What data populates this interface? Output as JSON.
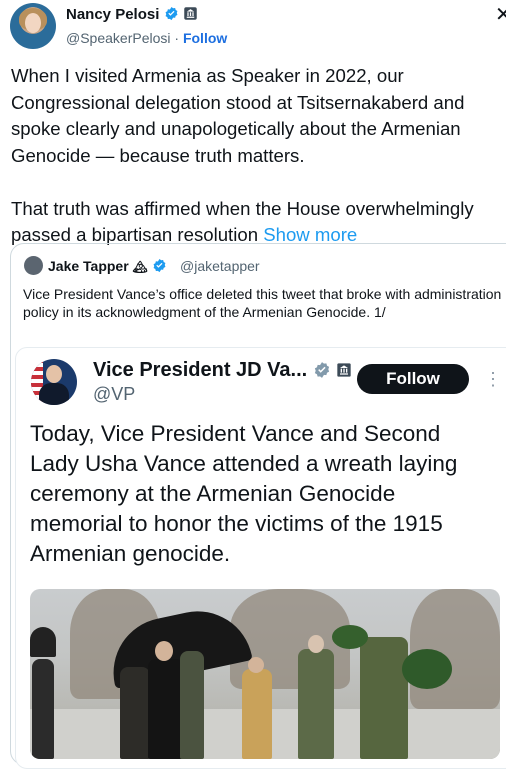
{
  "tweet": {
    "author_name": "Nancy Pelosi",
    "author_handle": "@SpeakerPelosi",
    "separator": "·",
    "follow_label": "Follow",
    "close_glyph": "✕",
    "text_lines": [
      "When I visited Armenia as Speaker in 2022, our",
      "Congressional delegation stood at Tsitsernakaberd and",
      "spoke clearly and unapologetically about the Armenian",
      "Genocide — because truth matters.",
      "",
      "That truth was affirmed when the House overwhelmingly",
      "passed a bipartisan resolution"
    ],
    "show_more": "Show more"
  },
  "quoted": {
    "author_name": "Jake Tapper",
    "badge_glyph": "🏔",
    "author_handle": "@jaketapper",
    "text": "Vice President Vance’s office deleted this tweet that broke with administration policy in its acknowledgment of the Armenian Genocide. 1/"
  },
  "embedded": {
    "author_name": "Vice President JD Va...",
    "author_handle": "@VP",
    "follow_label": "Follow",
    "more_glyph": "⋮",
    "text_lines": [
      "Today, Vice President Vance and Second",
      "Lady Usha Vance attended a wreath laying",
      "ceremony at the Armenian Genocide",
      "memorial to honor the victims of the 1915",
      "Armenian genocide."
    ]
  },
  "icons": {
    "verified_color": "#1d9bf0",
    "gov_badge_color": "#829aab"
  },
  "colors": {
    "link": "#1d9bf0",
    "follow_link": "#1d6fe0",
    "follow_button_bg": "#0f1419"
  }
}
